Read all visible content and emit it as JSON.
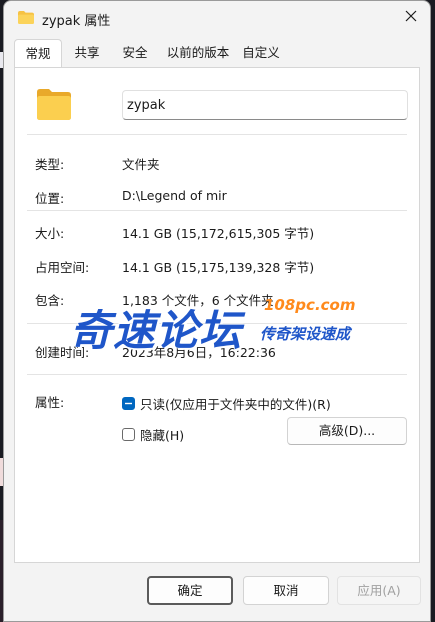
{
  "window": {
    "title": "zypak 属性"
  },
  "tabs": [
    {
      "label": "常规",
      "active": true
    },
    {
      "label": "共享",
      "active": false
    },
    {
      "label": "安全",
      "active": false
    },
    {
      "label": "以前的版本",
      "active": false
    },
    {
      "label": "自定义",
      "active": false
    }
  ],
  "general": {
    "name_value": "zypak",
    "rows": [
      {
        "label": "类型:",
        "value": "文件夹"
      },
      {
        "label": "位置:",
        "value": "D:\\Legend of mir"
      },
      {
        "label": "大小:",
        "value": "14.1 GB (15,172,615,305 字节)"
      },
      {
        "label": "占用空间:",
        "value": "14.1 GB (15,175,139,328 字节)"
      },
      {
        "label": "包含:",
        "value": "1,183 个文件，6 个文件夹"
      },
      {
        "label": "创建时间:",
        "value": "2023年8月6日，16:22:36"
      }
    ],
    "attributes_label": "属性:",
    "readonly_label": "只读(仅应用于文件夹中的文件)(R)",
    "readonly_checked": true,
    "hidden_label": "隐藏(H)",
    "hidden_checked": false,
    "advanced_button": "高级(D)..."
  },
  "buttons": {
    "ok": "确定",
    "cancel": "取消",
    "apply": "应用(A)"
  },
  "watermark": {
    "big": "奇速论坛",
    "url": "108pc.com",
    "small": "传奇架设速成"
  },
  "colors": {
    "accent": "#0067c0",
    "folder": "#f6c244",
    "watermark_blue": "#1f56c9",
    "watermark_orange": "#ff8a1c"
  }
}
